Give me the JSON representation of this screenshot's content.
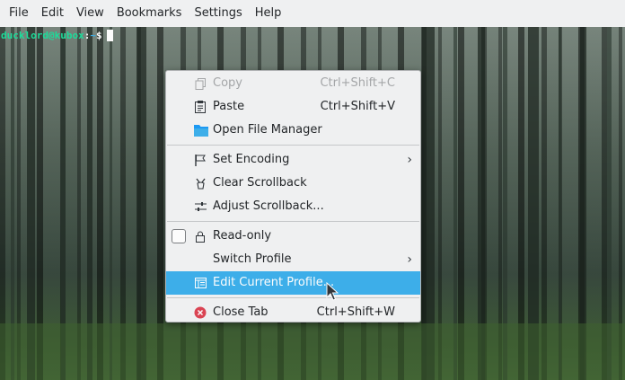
{
  "menubar": {
    "items": [
      "File",
      "Edit",
      "View",
      "Bookmarks",
      "Settings",
      "Help"
    ]
  },
  "terminal": {
    "prompt_user": "ducklord@kubox",
    "prompt_sep": ":",
    "prompt_path": "~",
    "prompt_symbol": "$"
  },
  "context_menu": {
    "copy": {
      "label": "Copy",
      "shortcut": "Ctrl+Shift+C",
      "icon": "copy-icon",
      "enabled": false
    },
    "paste": {
      "label": "Paste",
      "shortcut": "Ctrl+Shift+V",
      "icon": "paste-icon"
    },
    "open_file_manager": {
      "label": "Open File Manager",
      "icon": "folder-icon"
    },
    "set_encoding": {
      "label": "Set Encoding",
      "icon": "flag-icon"
    },
    "clear_scrollback": {
      "label": "Clear Scrollback",
      "icon": "broom-icon"
    },
    "adjust_scrollback": {
      "label": "Adjust Scrollback...",
      "icon": "sliders-icon"
    },
    "read_only": {
      "label": "Read-only",
      "icon": "lock-icon",
      "checked": false
    },
    "switch_profile": {
      "label": "Switch Profile"
    },
    "edit_current_profile": {
      "label": "Edit Current Profile...",
      "icon": "profile-icon",
      "highlighted": true
    },
    "close_tab": {
      "label": "Close Tab",
      "shortcut": "Ctrl+Shift+W",
      "icon": "close-tab-icon"
    }
  },
  "colors": {
    "highlight": "#3daee9",
    "menu_bg": "#eff0f1",
    "prompt_user": "#1cdc9a",
    "prompt_path": "#3daee9",
    "close_icon": "#da4453",
    "folder_icon": "#1d99f3"
  }
}
